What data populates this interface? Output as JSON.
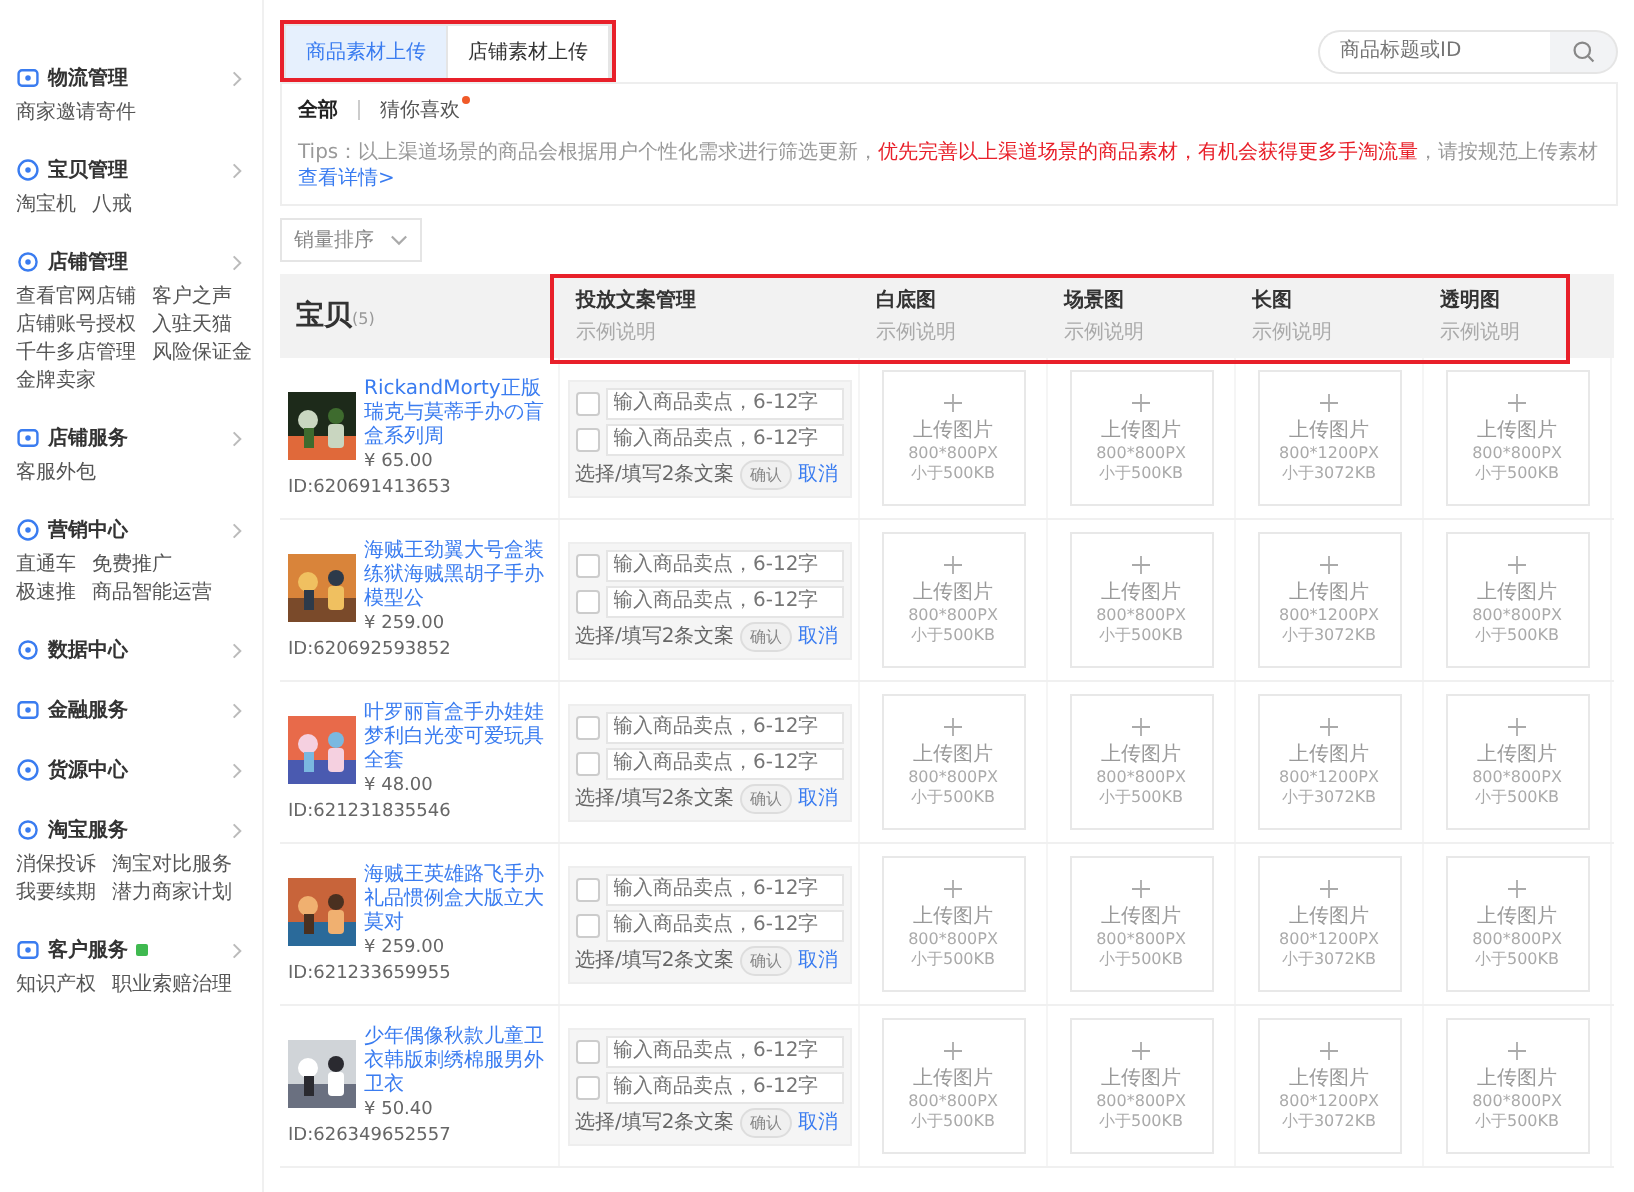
{
  "sidebar": {
    "groups": [
      {
        "title": "物流管理",
        "badge": false,
        "items": [
          "商家邀请寄件"
        ]
      },
      {
        "title": "宝贝管理",
        "badge": false,
        "items": [
          "淘宝机",
          "八戒"
        ]
      },
      {
        "title": "店铺管理",
        "badge": false,
        "items": [
          "查看官网店铺",
          "客户之声",
          "店铺账号授权",
          "入驻天猫",
          "千牛多店管理",
          "风险保证金",
          "金牌卖家"
        ]
      },
      {
        "title": "店铺服务",
        "badge": false,
        "items": [
          "客服外包"
        ]
      },
      {
        "title": "营销中心",
        "badge": false,
        "items": [
          "直通车",
          "免费推广",
          "极速推",
          "商品智能运营"
        ]
      },
      {
        "title": "数据中心",
        "badge": false
      },
      {
        "title": "金融服务",
        "badge": false
      },
      {
        "title": "货源中心",
        "badge": false
      },
      {
        "title": "淘宝服务",
        "badge": false,
        "items": [
          "消保投诉",
          "淘宝对比服务",
          "我要续期",
          "潜力商家计划"
        ]
      },
      {
        "title": "客户服务",
        "badge": true,
        "items": [
          "知识产权",
          "职业索赔治理"
        ]
      }
    ]
  },
  "tabs": [
    {
      "label": "商品素材上传",
      "selected": true
    },
    {
      "label": "店铺素材上传",
      "selected": false
    }
  ],
  "search": {
    "placeholder": "商品标题或ID"
  },
  "filters": [
    {
      "label": "全部",
      "selected": true,
      "dot": false
    },
    {
      "label": "猜你喜欢",
      "selected": false,
      "dot": true
    }
  ],
  "tips": [
    {
      "kind": "plain",
      "text": "Tips：以上渠道场景的商品会根据用户个性化需求进行筛选更新，"
    },
    {
      "kind": "highlight",
      "text": "优先完善以上渠道场景的商品素材，有机会获得更多手淘流量"
    },
    {
      "kind": "plain",
      "text": "，请按规范上传素材"
    },
    {
      "kind": "link",
      "text": "查看详情>"
    }
  ],
  "sort": {
    "value": "销量排序"
  },
  "table": {
    "columns": [
      {
        "title": "宝贝",
        "count": "(5)"
      },
      {
        "title": "投放文案管理",
        "hint": "示例说明"
      },
      {
        "title": "白底图",
        "hint": "示例说明"
      },
      {
        "title": "场景图",
        "hint": "示例说明"
      },
      {
        "title": "长图",
        "hint": "示例说明"
      },
      {
        "title": "透明图",
        "hint": "示例说明"
      }
    ],
    "rows": [
      {
        "title": "RickandMorty正版瑞克与莫蒂手办の盲盒系列周",
        "price": "¥ 65.00",
        "id": "ID:620691413653",
        "copy": {
          "inputs": [
            {
              "placeholder": "输入商品卖点，6-12字",
              "checked": false
            },
            {
              "placeholder": "输入商品卖点，6-12字",
              "checked": false
            }
          ],
          "label": "选择/填写2条文案",
          "confirm": {
            "label": "确认",
            "disabled": true
          },
          "cancel": "取消"
        },
        "uploads": [
          {
            "label": "上传图片",
            "size": "800*800PX",
            "limit": "小于500KB"
          },
          {
            "label": "上传图片",
            "size": "800*800PX",
            "limit": "小于500KB"
          },
          {
            "label": "上传图片",
            "size": "800*1200PX",
            "limit": "小于3072KB"
          },
          {
            "label": "上传图片",
            "size": "800*800PX",
            "limit": "小于500KB"
          }
        ]
      },
      {
        "title": "海贼王劲翼大号盒装练狱海贼黑胡子手办模型公",
        "price": "¥ 259.00",
        "id": "ID:620692593852",
        "copy": {
          "inputs": [
            {
              "placeholder": "输入商品卖点，6-12字",
              "checked": false
            },
            {
              "placeholder": "输入商品卖点，6-12字",
              "checked": false
            }
          ],
          "label": "选择/填写2条文案",
          "confirm": {
            "label": "确认",
            "disabled": true
          },
          "cancel": "取消"
        },
        "uploads": [
          {
            "label": "上传图片",
            "size": "800*800PX",
            "limit": "小于500KB"
          },
          {
            "label": "上传图片",
            "size": "800*800PX",
            "limit": "小于500KB"
          },
          {
            "label": "上传图片",
            "size": "800*1200PX",
            "limit": "小于3072KB"
          },
          {
            "label": "上传图片",
            "size": "800*800PX",
            "limit": "小于500KB"
          }
        ]
      },
      {
        "title": "叶罗丽盲盒手办娃娃梦利白光变可爱玩具全套",
        "price": "¥ 48.00",
        "id": "ID:621231835546",
        "copy": {
          "inputs": [
            {
              "placeholder": "输入商品卖点，6-12字",
              "checked": false
            },
            {
              "placeholder": "输入商品卖点，6-12字",
              "checked": false
            }
          ],
          "label": "选择/填写2条文案",
          "confirm": {
            "label": "确认",
            "disabled": true
          },
          "cancel": "取消"
        },
        "uploads": [
          {
            "label": "上传图片",
            "size": "800*800PX",
            "limit": "小于500KB"
          },
          {
            "label": "上传图片",
            "size": "800*800PX",
            "limit": "小于500KB"
          },
          {
            "label": "上传图片",
            "size": "800*1200PX",
            "limit": "小于3072KB"
          },
          {
            "label": "上传图片",
            "size": "800*800PX",
            "limit": "小于500KB"
          }
        ]
      },
      {
        "title": "海贼王英雄路飞手办礼品惯例盒大版立大莫对",
        "price": "¥ 259.00",
        "id": "ID:621233659955",
        "copy": {
          "inputs": [
            {
              "placeholder": "输入商品卖点，6-12字",
              "checked": false
            },
            {
              "placeholder": "输入商品卖点，6-12字",
              "checked": false
            }
          ],
          "label": "选择/填写2条文案",
          "confirm": {
            "label": "确认",
            "disabled": true
          },
          "cancel": "取消"
        },
        "uploads": [
          {
            "label": "上传图片",
            "size": "800*800PX",
            "limit": "小于500KB"
          },
          {
            "label": "上传图片",
            "size": "800*800PX",
            "limit": "小于500KB"
          },
          {
            "label": "上传图片",
            "size": "800*1200PX",
            "limit": "小于3072KB"
          },
          {
            "label": "上传图片",
            "size": "800*800PX",
            "limit": "小于500KB"
          }
        ]
      },
      {
        "title": "少年偶像秋款儿童卫衣韩版刺绣棉服男外卫衣",
        "price": "¥ 50.40",
        "id": "ID:626349652557",
        "copy": {
          "inputs": [
            {
              "placeholder": "输入商品卖点，6-12字",
              "checked": false
            },
            {
              "placeholder": "输入商品卖点，6-12字",
              "checked": false
            }
          ],
          "label": "选择/填写2条文案",
          "confirm": {
            "label": "确认",
            "disabled": true
          },
          "cancel": "取消"
        },
        "uploads": [
          {
            "label": "上传图片",
            "size": "800*800PX",
            "limit": "小于500KB"
          },
          {
            "label": "上传图片",
            "size": "800*800PX",
            "limit": "小于500KB"
          },
          {
            "label": "上传图片",
            "size": "800*1200PX",
            "limit": "小于3072KB"
          },
          {
            "label": "上传图片",
            "size": "800*800PX",
            "limit": "小于500KB"
          }
        ]
      }
    ]
  }
}
